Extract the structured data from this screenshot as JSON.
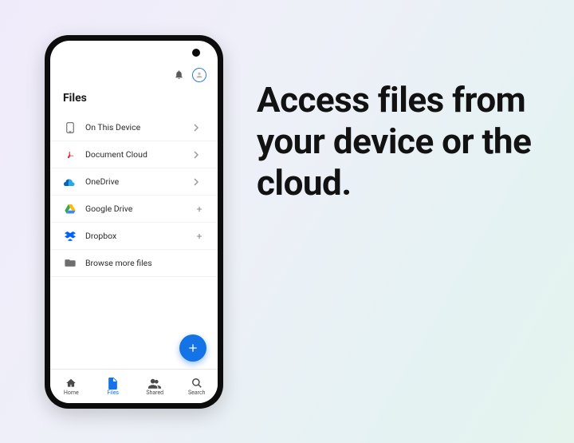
{
  "headline": "Access files from your device or the cloud.",
  "screen_title": "Files",
  "sources": [
    {
      "label": "On This Device",
      "icon": "device",
      "tail": "chevron"
    },
    {
      "label": "Document Cloud",
      "icon": "acrobat",
      "tail": "chevron"
    },
    {
      "label": "OneDrive",
      "icon": "onedrive",
      "tail": "chevron"
    },
    {
      "label": "Google Drive",
      "icon": "gdrive",
      "tail": "plus"
    },
    {
      "label": "Dropbox",
      "icon": "dropbox",
      "tail": "plus"
    },
    {
      "label": "Browse more files",
      "icon": "folder",
      "tail": ""
    }
  ],
  "nav": {
    "home": "Home",
    "files": "Files",
    "shared": "Shared",
    "search": "Search"
  },
  "colors": {
    "accent": "#1473e6",
    "acrobat": "#ed2224",
    "onedrive": "#0364b8",
    "gdrive_green": "#34a853",
    "gdrive_yellow": "#fbbc05",
    "gdrive_blue": "#4285f4",
    "dropbox": "#0061ff"
  }
}
